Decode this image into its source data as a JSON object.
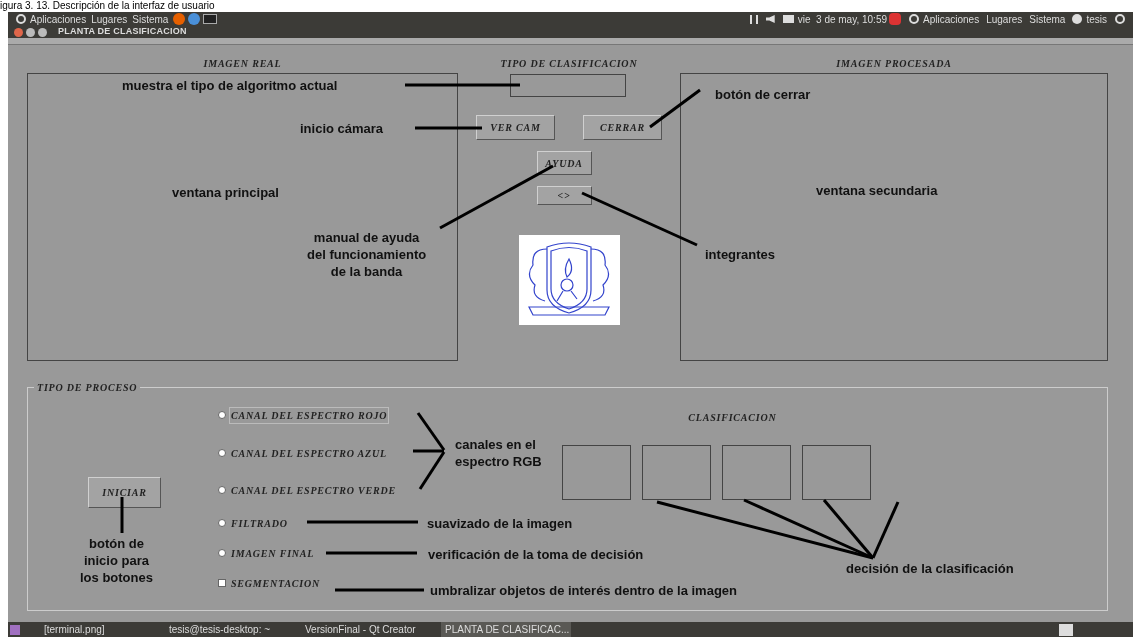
{
  "caption": "igura 3. 13. Descripción de la interfaz de usuario",
  "top_panel": {
    "menus_left": [
      "Aplicaciones",
      "Lugares",
      "Sistema"
    ],
    "clock": "vie  3 de may, 10:59",
    "menus_right": [
      "Aplicaciones",
      "Lugares",
      "Sistema"
    ],
    "user": "tesis"
  },
  "window": {
    "title": "PLANTA DE CLASIFICACION",
    "real_image": {
      "label": "IMAGEN REAL"
    },
    "classification_type": {
      "label": "TIPO  DE CLASIFICACION"
    },
    "buttons": [
      {
        "label": "VER CAM"
      },
      {
        "label": "CERRAR"
      },
      {
        "label": "AYUDA"
      },
      {
        "label": "<>"
      }
    ],
    "processed_image": {
      "label": "IMAGEN PROCESADA"
    },
    "process_group": {
      "title": "TIPO DE PROCESO",
      "start_button": "INICIAR",
      "options": [
        {
          "kind": "radio",
          "label": "CANAL DEL ESPECTRO ROJO",
          "checked": false,
          "focused": true
        },
        {
          "kind": "radio",
          "label": "CANAL DEL ESPECTRO AZUL",
          "checked": false,
          "focused": false
        },
        {
          "kind": "radio",
          "label": "CANAL DEL ESPECTRO VERDE",
          "checked": false,
          "focused": false
        },
        {
          "kind": "radio",
          "label": "FILTRADO",
          "checked": false,
          "focused": false
        },
        {
          "kind": "radio",
          "label": "IMAGEN FINAL",
          "checked": false,
          "focused": false
        },
        {
          "kind": "checkbox",
          "label": "SEGMENTACION",
          "checked": false,
          "focused": false
        }
      ],
      "classification": {
        "label": "CLASIFICACION"
      }
    }
  },
  "annotations": [
    {
      "lines": [
        "muestra el tipo de algoritmo actual"
      ]
    },
    {
      "lines": [
        "inicio cámara"
      ]
    },
    {
      "lines": [
        "ventana principal"
      ]
    },
    {
      "lines": [
        "manual de ayuda",
        "del funcionamiento",
        "de la banda"
      ]
    },
    {
      "lines": [
        "botón de cerrar"
      ]
    },
    {
      "lines": [
        "integrantes"
      ]
    },
    {
      "lines": [
        "ventana secundaria"
      ]
    },
    {
      "lines": [
        "canales en el",
        "espectro RGB"
      ]
    },
    {
      "lines": [
        "suavizado de la imagen"
      ]
    },
    {
      "lines": [
        "verificación de la toma de decisión"
      ]
    },
    {
      "lines": [
        "umbralizar objetos de interés dentro de la imagen"
      ]
    },
    {
      "lines": [
        "botón de",
        "inicio para",
        "los botones"
      ]
    },
    {
      "lines": [
        "decisión de la clasificación"
      ]
    }
  ],
  "taskbar": [
    {
      "label": "[terminal.png]",
      "selected": false
    },
    {
      "label": "tesis@tesis-desktop: ~",
      "selected": false
    },
    {
      "label": "VersionFinal - Qt Creator",
      "selected": false
    },
    {
      "label": "PLANTA DE CLASIFICAC...",
      "selected": true
    }
  ]
}
